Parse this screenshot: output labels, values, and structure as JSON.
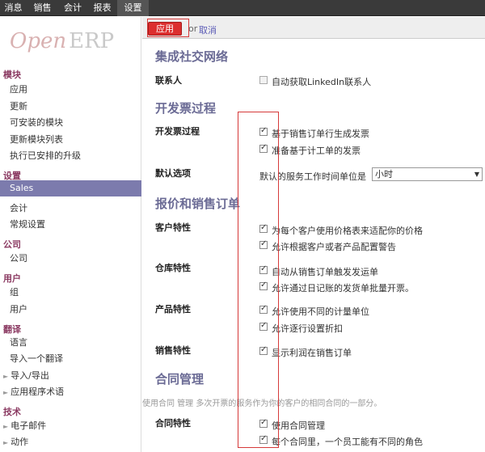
{
  "topnav": {
    "items": [
      {
        "label": "消息"
      },
      {
        "label": "销售"
      },
      {
        "label": "会计"
      },
      {
        "label": "报表"
      },
      {
        "label": "设置",
        "active": true
      }
    ]
  },
  "logo": {
    "open": "Open",
    "erp": "ERP"
  },
  "sidebar": {
    "sections": [
      {
        "title": "模块",
        "items": [
          "应用",
          "更新",
          "可安装的模块",
          "更新模块列表",
          "执行已安排的升级"
        ]
      },
      {
        "title": "设置",
        "items": [
          "Sales",
          "会计",
          "常规设置"
        ],
        "selected": "Sales"
      },
      {
        "title": "公司",
        "items": [
          "公司"
        ]
      },
      {
        "title": "用户",
        "items": [
          "组",
          "用户"
        ]
      },
      {
        "title": "翻译",
        "items": [
          "语言",
          "导入一个翻译",
          "导入/导出",
          "应用程序术语"
        ]
      },
      {
        "title": "技术",
        "items": [
          "电子邮件",
          "动作"
        ]
      }
    ]
  },
  "toolbar": {
    "apply_label": "应用",
    "or_label": "or",
    "cancel_label": "取消"
  },
  "sections": {
    "social": {
      "title": "集成社交网络",
      "contacts_label": "联系人",
      "linkedin_label": "自动获取LinkedIn联系人",
      "linkedin_checked": false
    },
    "invoicing": {
      "title": "开发票过程",
      "process_label": "开发票过程",
      "opt1": "基于销售订单行生成发票",
      "opt2": "准备基于计工单的发票",
      "defaults_label": "默认选项",
      "unit_label": "默认的服务工作时间单位是",
      "unit_value": "小时"
    },
    "quotations": {
      "title": "报价和销售订单",
      "customer_label": "客户特性",
      "customer_opt1": "为每个客户使用价格表来适配你的价格",
      "customer_opt2": "允许根据客户或者产品配置警告",
      "warehouse_label": "仓库特性",
      "warehouse_opt1": "自动从销售订单触发发运单",
      "warehouse_opt2": "允许通过日记账的发货单批量开票。",
      "product_label": "产品特性",
      "product_opt1": "允许使用不同的计量单位",
      "product_opt2": "允许逐行设置折扣",
      "sales_label": "销售特性",
      "sales_opt1": "显示利润在销售订单"
    },
    "contracts": {
      "title": "合同管理",
      "description": "使用合同 管理 多次开票的服务作为你的客户的相同合同的一部分。",
      "contract_label": "合同特性",
      "opt1": "使用合同管理",
      "opt2": "每个合同里，一个员工能有不同的角色"
    }
  }
}
